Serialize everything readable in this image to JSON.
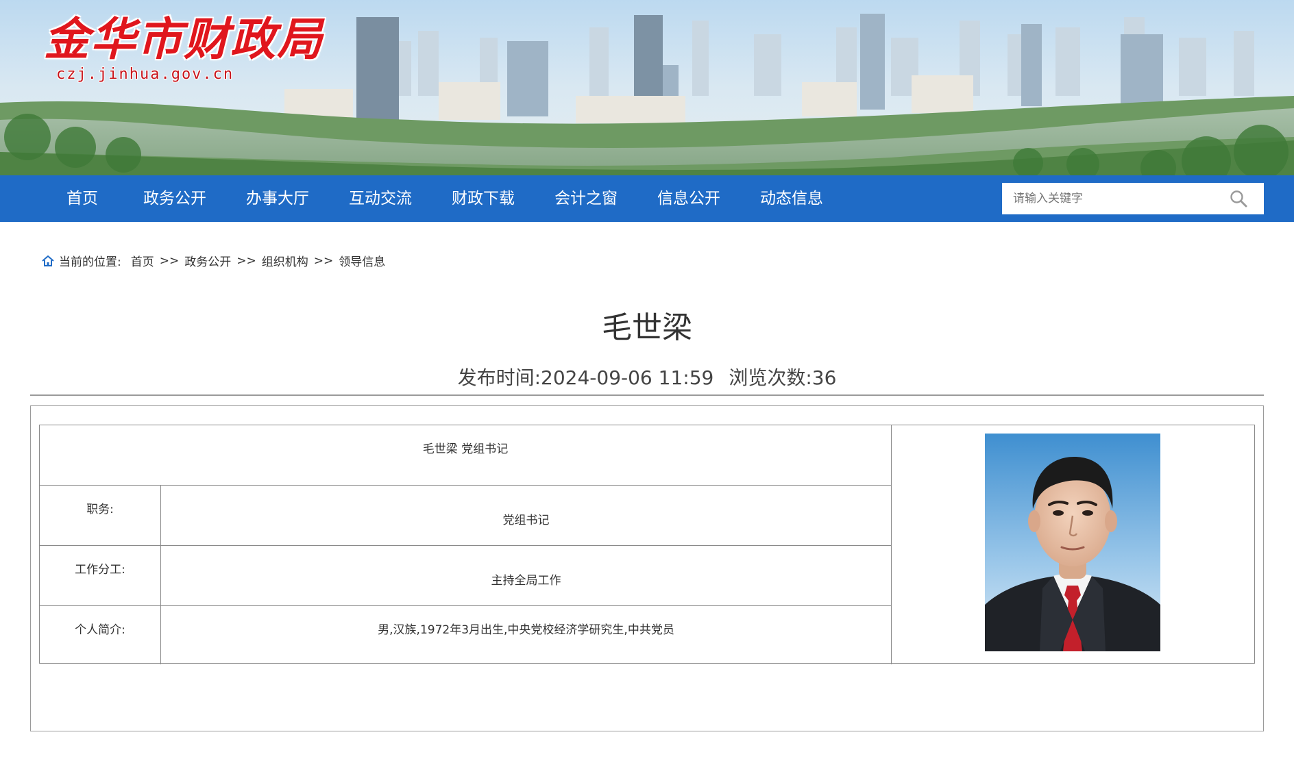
{
  "header": {
    "site_name": "金华市财政局",
    "site_url": "czj.jinhua.gov.cn"
  },
  "nav": {
    "items": [
      "首页",
      "政务公开",
      "办事大厅",
      "互动交流",
      "财政下载",
      "会计之窗",
      "信息公开",
      "动态信息"
    ]
  },
  "search": {
    "placeholder": "请输入关键字"
  },
  "breadcrumb": {
    "label": "当前的位置:",
    "items": [
      "首页",
      "政务公开",
      "组织机构",
      "领导信息"
    ],
    "separator": ">>"
  },
  "article": {
    "title": "毛世梁",
    "publish_time": "发布时间:2024-09-06 11:59",
    "view_count": "浏览次数:36"
  },
  "profile": {
    "name_title": "毛世梁 党组书记",
    "rows": [
      {
        "label": "职务:",
        "value": "党组书记"
      },
      {
        "label": "工作分工:",
        "value": "主持全局工作"
      },
      {
        "label": "个人简介:",
        "value": "男,汉族,1972年3月出生,中央党校经济学研究生,中共党员"
      }
    ]
  },
  "colors": {
    "nav_bg": "#1f6bc6",
    "logo_red": "#e0161d",
    "border_gray": "#8a8a8a"
  }
}
